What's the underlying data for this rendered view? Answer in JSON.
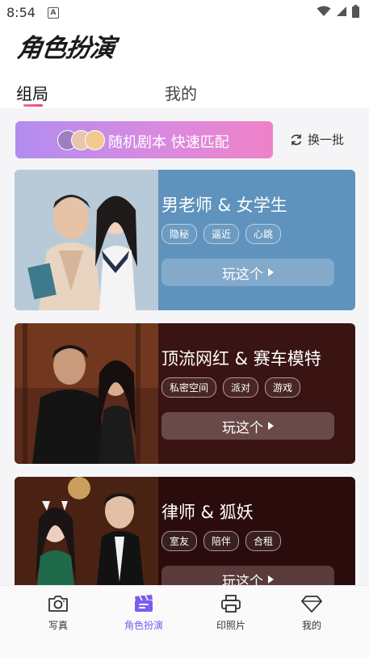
{
  "status": {
    "time": "8:54",
    "notification_icon": "A"
  },
  "app": {
    "title": "角色扮演"
  },
  "tabs": [
    {
      "label": "组局",
      "active": true
    },
    {
      "label": "我的",
      "active": false
    }
  ],
  "match_banner": {
    "label": "随机剧本 快速匹配"
  },
  "refresh": {
    "label": "换一批",
    "icon": "refresh-icon"
  },
  "cards": [
    {
      "title": "男老师 & 女学生",
      "tags": [
        "隐秘",
        "逼近",
        "心跳"
      ],
      "play_label": "玩这个",
      "bg": "#5f93bd",
      "btn": "#83aacb"
    },
    {
      "title": "顶流网红 & 赛车模特",
      "tags": [
        "私密空间",
        "派对",
        "游戏"
      ],
      "play_label": "玩这个",
      "bg": "#3a1412",
      "btn": "#6a4a48"
    },
    {
      "title": "律师 & 狐妖",
      "tags": [
        "室友",
        "陪伴",
        "合租"
      ],
      "play_label": "玩这个",
      "bg": "#2a0c0c",
      "btn": "#5a3a3a"
    }
  ],
  "bottom_nav": [
    {
      "label": "写真",
      "icon": "camera-icon",
      "active": false
    },
    {
      "label": "角色扮演",
      "icon": "clapperboard-icon",
      "active": true
    },
    {
      "label": "印照片",
      "icon": "printer-icon",
      "active": false
    },
    {
      "label": "我的",
      "icon": "diamond-icon",
      "active": false
    }
  ],
  "colors": {
    "accent": "#7b5cf0",
    "tab_underline": "#f0407a"
  }
}
